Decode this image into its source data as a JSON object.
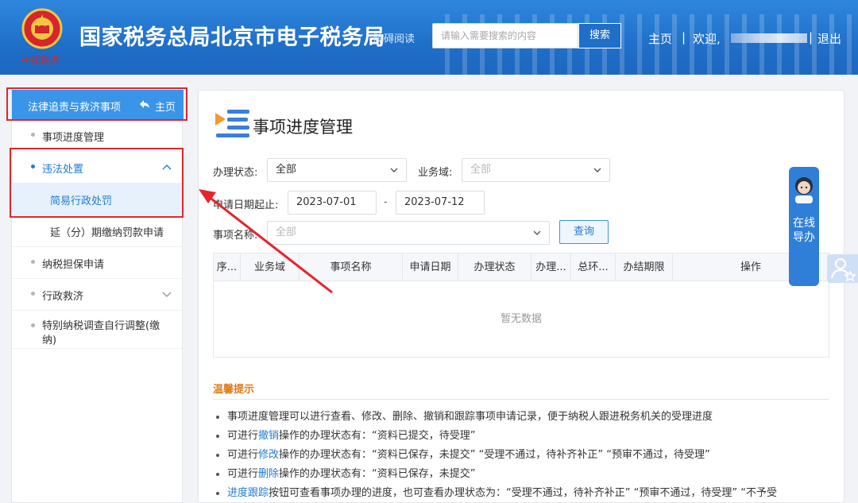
{
  "header": {
    "site_title": "国家税务总局北京市电子税务局",
    "accessible_read": "障碍阅读",
    "search_placeholder": "请输入需要搜索的内容",
    "search_button": "搜索",
    "home": "主页",
    "separator": "|",
    "welcome": "欢迎,",
    "logout": "退出"
  },
  "sidebar": {
    "title": "法律追责与救济事项",
    "home_link": "主页",
    "items": [
      {
        "label": "事项进度管理"
      },
      {
        "label": "违法处置"
      },
      {
        "label": "简易行政处罚"
      },
      {
        "label": "延（分）期缴纳罚款申请"
      },
      {
        "label": "纳税担保申请"
      },
      {
        "label": "行政救济"
      },
      {
        "label": "特别纳税调查自行调整(缴纳)"
      }
    ]
  },
  "main": {
    "title": "事项进度管理",
    "filters": {
      "status_label": "办理状态:",
      "status_value": "全部",
      "domain_label": "业务域:",
      "domain_value": "全部",
      "date_label": "申请日期起止:",
      "date_start": "2023-07-01",
      "date_sep": "-",
      "date_end": "2023-07-12",
      "item_label": "事项名称:",
      "item_value": "全部",
      "query_button": "查询"
    },
    "table": {
      "columns": [
        "序...",
        "业务域",
        "事项名称",
        "申请日期",
        "办理状态",
        "办理...",
        "总环...",
        "办结期限",
        "操作"
      ],
      "empty_text": "暂无数据"
    },
    "tips": {
      "title": "温馨提示",
      "lines": [
        {
          "pre": "事项进度管理可以进行查看、修改、删除、撤销和跟踪事项申请记录，便于纳税人跟进税务机关的受理进度",
          "link": "",
          "post": ""
        },
        {
          "pre": "可进行",
          "link": "撤销",
          "post": "操作的办理状态有：“资料已提交，待受理”"
        },
        {
          "pre": "可进行",
          "link": "修改",
          "post": "操作的办理状态有：“资料已保存，未提交”  “受理不通过，待补齐补正”  “预审不通过，待受理”"
        },
        {
          "pre": "可进行",
          "link": "删除",
          "post": "操作的办理状态有：“资料已保存，未提交”"
        },
        {
          "pre": "",
          "link": "进度跟踪",
          "post": "按钮可查看事项办理的进度，也可查看办理状态为：“受理不通过，待补齐补正”  “预审不通过，待受理”  “不予受"
        }
      ]
    }
  },
  "widgets": {
    "online_service": "在线导办"
  },
  "colors": {
    "header_blue": "#1f6fc9",
    "accent": "#1f7ad6",
    "highlight_red": "#e6242b",
    "tips_orange": "#e07b1a"
  }
}
